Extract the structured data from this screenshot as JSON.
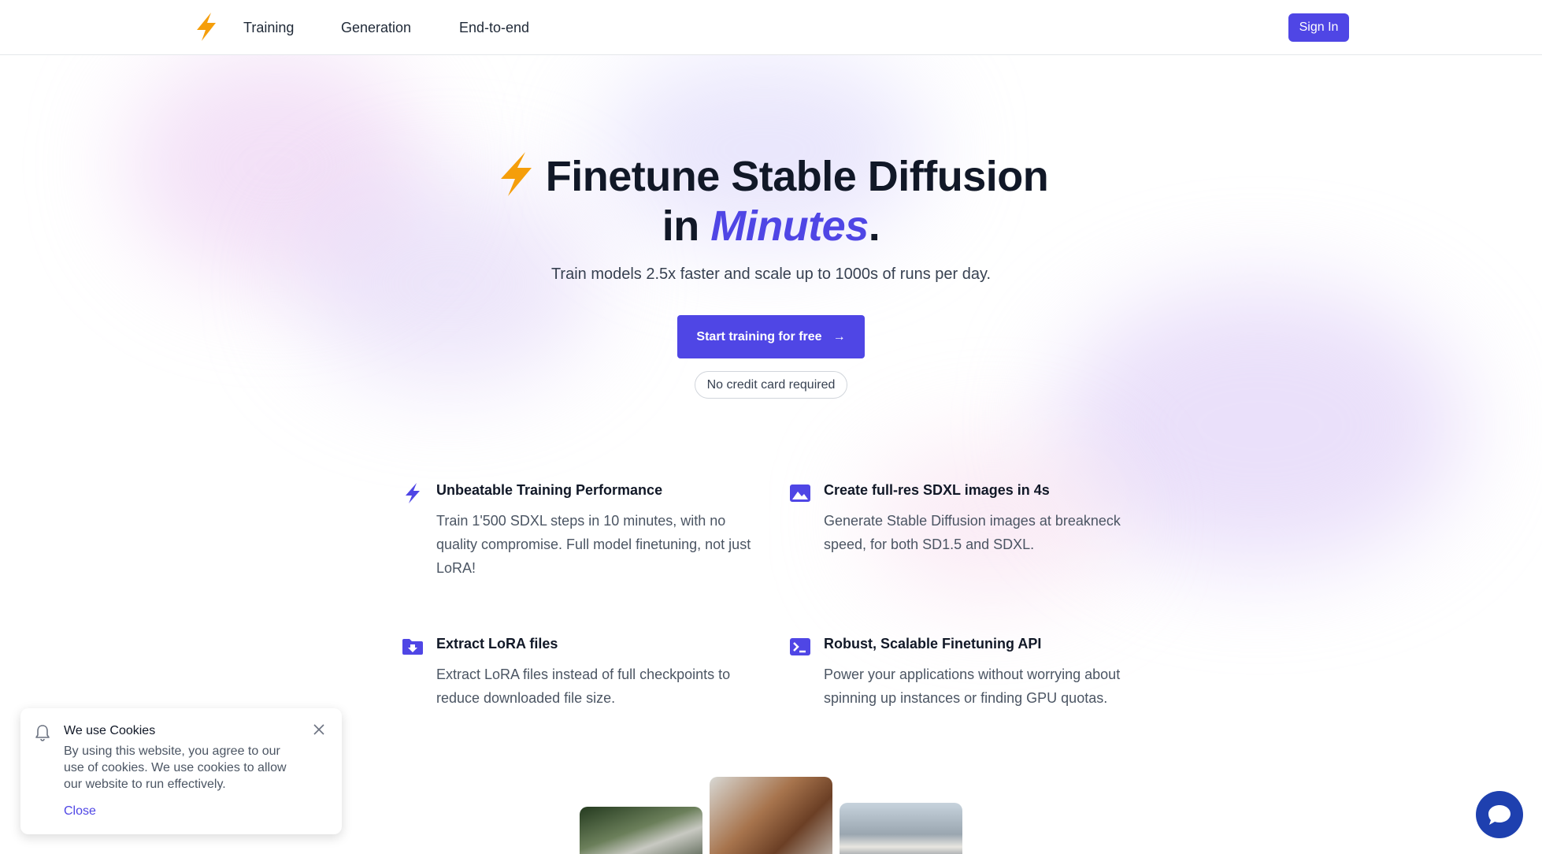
{
  "header": {
    "logo": "lightning-bolt",
    "nav": [
      "Training",
      "Generation",
      "End-to-end"
    ],
    "sign_in": "Sign In"
  },
  "hero": {
    "title_line1": "Finetune Stable Diffusion",
    "title_in": "in ",
    "title_minutes": "Minutes",
    "title_period": ".",
    "subtitle": "Train models 2.5x faster and scale up to 1000s of runs per day.",
    "cta_label": "Start training for free",
    "cta_arrow": "→",
    "no_credit_card": "No credit card required"
  },
  "features": [
    {
      "icon": "bolt-icon",
      "title": "Unbeatable Training Performance",
      "text": "Train 1'500 SDXL steps in 10 minutes, with no quality compromise. Full model finetuning, not just LoRA!"
    },
    {
      "icon": "image-icon",
      "title": "Create full-res SDXL images in 4s",
      "text": "Generate Stable Diffusion images at breakneck speed, for both SD1.5 and SDXL."
    },
    {
      "icon": "folder-download-icon",
      "title": "Extract LoRA files",
      "text": "Extract LoRA files instead of full checkpoints to reduce downloaded file size."
    },
    {
      "icon": "terminal-icon",
      "title": "Robust, Scalable Finetuning API",
      "text": "Power your applications without worrying about spinning up instances or finding GPU quotas."
    }
  ],
  "cookie": {
    "title": "We use Cookies",
    "text": "By using this website, you agree to our use of cookies. We use cookies to allow our website to run effectively.",
    "close": "Close"
  },
  "colors": {
    "accent": "#4f46e5",
    "bolt": "#f59e0b",
    "chat": "#1e40af"
  }
}
